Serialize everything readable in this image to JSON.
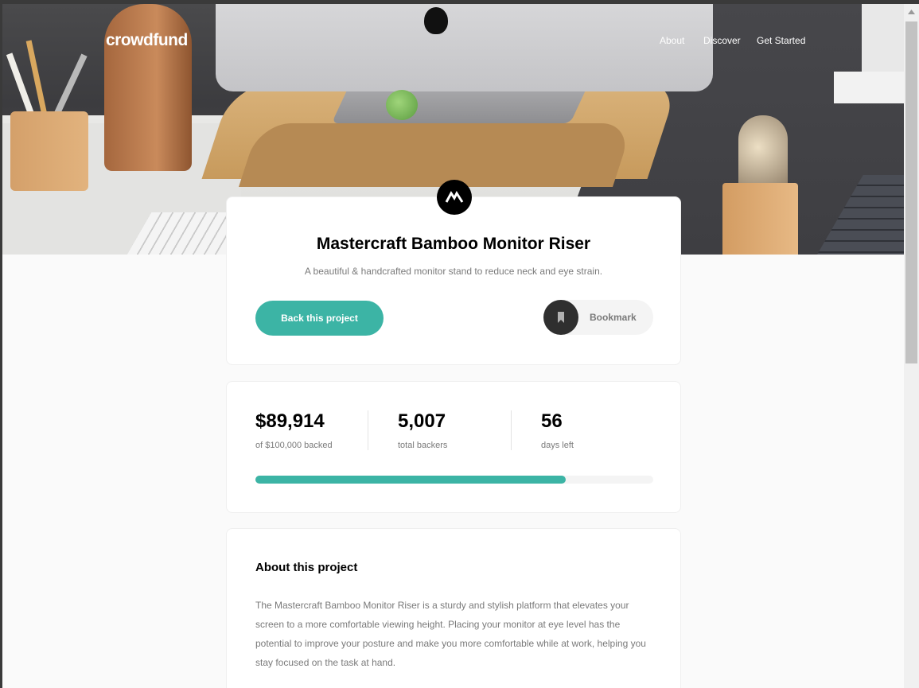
{
  "nav": {
    "brand": "crowdfund",
    "links": [
      "About",
      "Discover",
      "Get Started"
    ]
  },
  "project": {
    "title": "Mastercraft Bamboo Monitor Riser",
    "description": "A beautiful & handcrafted monitor stand to reduce neck and eye strain.",
    "back_label": "Back this project",
    "bookmark_label": "Bookmark",
    "logo_icon": "mastercraft-logo-icon",
    "bookmark_icon": "bookmark-icon"
  },
  "stats": {
    "backed_value": "$89,914",
    "backed_label": "of $100,000 backed",
    "backers_value": "5,007",
    "backers_label": "total backers",
    "days_value": "56",
    "days_label": "days left",
    "progress_fraction": 0.78
  },
  "about": {
    "title": "About this project",
    "text": "The Mastercraft Bamboo Monitor Riser is a sturdy and stylish platform that elevates your screen to a more comfortable viewing height. Placing your monitor at eye level has the potential to improve your posture and make you more comfortable while at work, helping you stay focused on the task at hand."
  },
  "colors": {
    "accent": "#3cb4a5",
    "dark": "#2f2f2f"
  }
}
